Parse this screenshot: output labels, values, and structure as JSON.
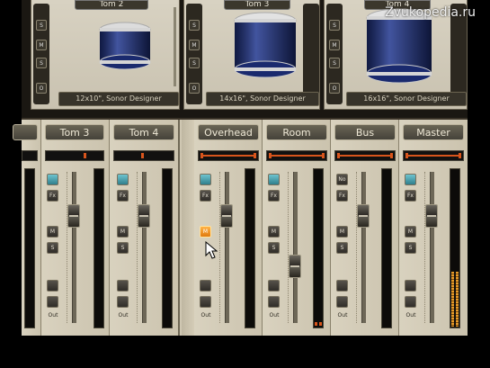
{
  "watermark": "Zvukopedia.ru",
  "drum_kits": [
    {
      "title": "Tom 2",
      "caption": "12x10\", Sonor Designer"
    },
    {
      "title": "Tom 3",
      "caption": "14x16\", Sonor Designer"
    },
    {
      "title": "Tom 4",
      "caption": "16x16\", Sonor Designer"
    }
  ],
  "drum_side_buttons": [
    "S",
    "M",
    "S",
    "O"
  ],
  "strips": [
    {
      "name": "",
      "group": "drums"
    },
    {
      "name": "Tom 3",
      "group": "drums"
    },
    {
      "name": "Tom 4",
      "group": "drums"
    },
    {
      "name": "Overhead",
      "group": "bus"
    },
    {
      "name": "Room",
      "group": "bus"
    },
    {
      "name": "Bus",
      "group": "bus"
    },
    {
      "name": "Master",
      "group": "bus"
    }
  ],
  "strip_buttons": {
    "fx": "Fx",
    "mute": "M",
    "solo": "S",
    "out": "Out",
    "no": "No"
  },
  "fader_levels": {
    "Tom 3": 0.75,
    "Tom 4": 0.75,
    "Overhead": 0.75,
    "Room": 0.35,
    "Bus": 0.75,
    "Master": 0.75
  },
  "master_meter_level": 0.35,
  "colors": {
    "accent_orange": "#d8551c",
    "panel_beige": "#d9d2bf",
    "dark": "#0c0b09",
    "selected_cyan": "#2f7f8c"
  }
}
